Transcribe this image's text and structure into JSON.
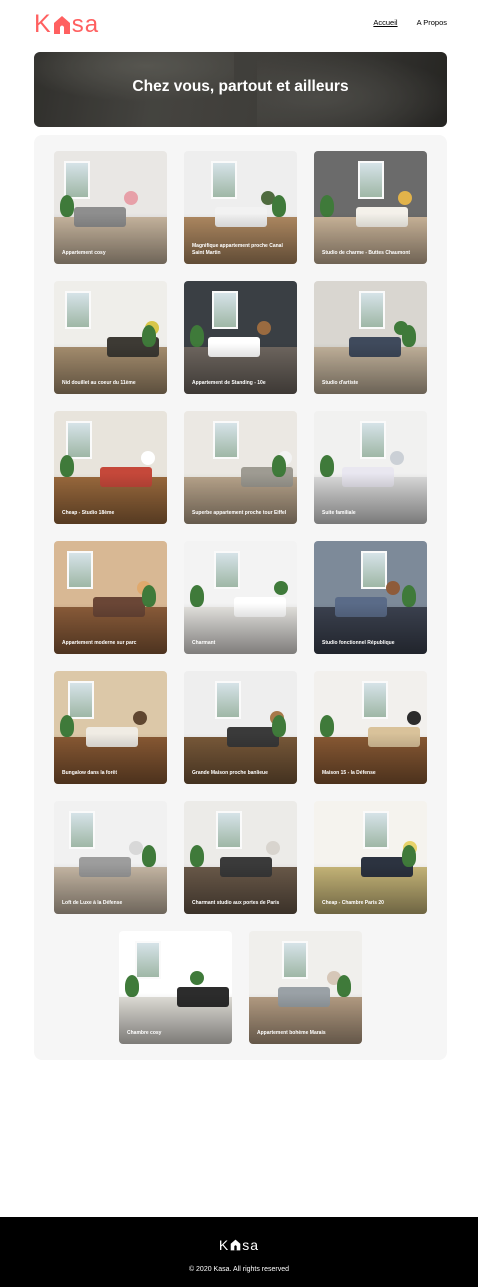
{
  "brand": {
    "name": "Kasa",
    "logo_parts": [
      "K",
      "sa"
    ],
    "icon": "house-icon",
    "color": "#FF6060"
  },
  "nav": [
    {
      "label": "Accueil",
      "active": true
    },
    {
      "label": "A Propos",
      "active": false
    }
  ],
  "hero": {
    "title": "Chez vous, partout et ailleurs"
  },
  "listings": [
    {
      "title": "Appartement cosy"
    },
    {
      "title": "Magnifique appartement proche Canal Saint Martin"
    },
    {
      "title": "Studio de charme - Buttes Chaumont"
    },
    {
      "title": "Nid douillet au coeur du 11ème"
    },
    {
      "title": "Appartement de Standing - 10e"
    },
    {
      "title": "Studio d'artiste"
    },
    {
      "title": "Cheap - Studio 18ème"
    },
    {
      "title": "Superbe appartement proche tour Eiffel"
    },
    {
      "title": "Suite familiale"
    },
    {
      "title": "Appartement moderne sur parc"
    },
    {
      "title": "Charmant"
    },
    {
      "title": "Studio fonctionnel République"
    },
    {
      "title": "Bungalow dans la forêt"
    },
    {
      "title": "Grande Maison proche banlieue"
    },
    {
      "title": "Maison 15 - la Défense"
    },
    {
      "title": "Loft de Luxe à la Défense"
    },
    {
      "title": "Charmant studio aux portes de Paris"
    },
    {
      "title": "Cheap - Chambre Paris 20"
    },
    {
      "title": "Chambre cosy"
    },
    {
      "title": "Appartement bohème Marais"
    }
  ],
  "footer": {
    "logo_parts": [
      "K",
      "sa"
    ],
    "copyright": "© 2020 Kasa. All rights reserved"
  }
}
